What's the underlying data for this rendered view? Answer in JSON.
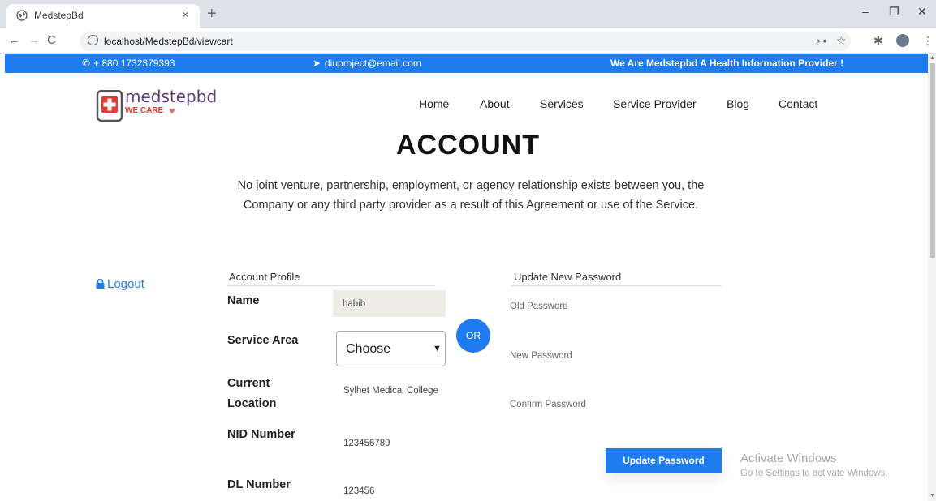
{
  "browser": {
    "tab_title": "MedstepBd",
    "tab_close": "×",
    "new_tab": "+",
    "url": "localhost/MedstepBd/viewcart",
    "window_minimize": "–",
    "window_restore": "❐",
    "window_close": "✕"
  },
  "topbar": {
    "phone": "+ 880 1732379393",
    "email": "diuproject@email.com",
    "tagline": "We Are Medstepbd A Health Information Provider !"
  },
  "brand": {
    "logo_text": "medstepbd",
    "logo_tagline": "WE CARE"
  },
  "nav": {
    "items": [
      "Home",
      "About",
      "Services",
      "Service Provider",
      "Blog",
      "Contact"
    ]
  },
  "page": {
    "title": "ACCOUNT",
    "intro": "No joint venture, partnership, employment, or agency relationship exists between you, the Company or any third party provider as a result of this Agreement or use of the Service.",
    "logout_label": "Logout"
  },
  "profile": {
    "section_title": "Account Profile",
    "name_label": "Name",
    "name_value": "habib",
    "service_area_label": "Service Area",
    "service_area_value": "Choose",
    "location_label_1": "Current",
    "location_label_2": "Location",
    "location_value": "Sylhet Medical College",
    "nid_label": "NID Number",
    "nid_value": "123456789",
    "dl_label": "DL Number",
    "dl_value": "123456"
  },
  "or_label": "OR",
  "password": {
    "section_title": "Update New Password",
    "old_placeholder": "Old Password",
    "new_placeholder": "New Password",
    "confirm_placeholder": "Confirm Password",
    "button_label": "Update Password"
  },
  "os_watermark": {
    "line1": "Activate Windows",
    "line2": "Go to Settings to activate Windows."
  },
  "colors": {
    "accent": "#1e7cf0",
    "chrome_bg": "#dee1e6",
    "name_field_bg": "#eeede7"
  }
}
